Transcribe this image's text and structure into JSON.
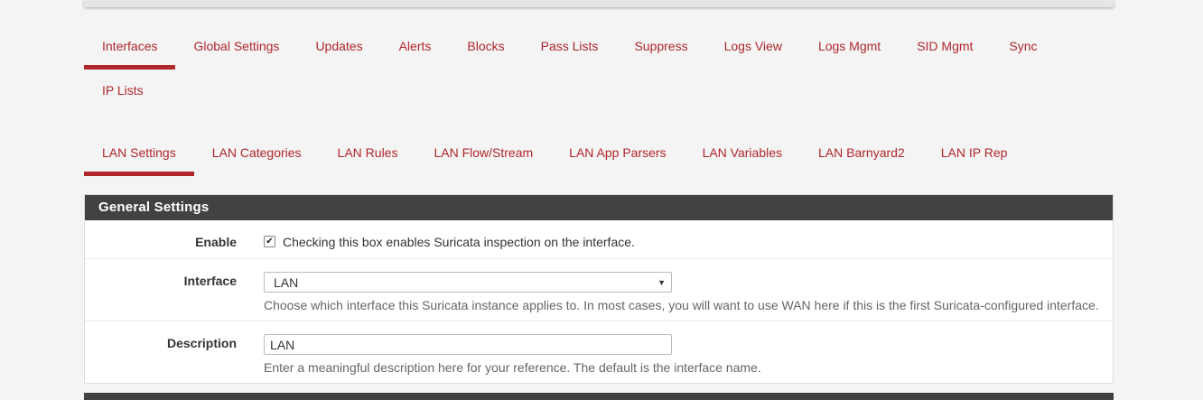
{
  "main_tabs": [
    {
      "label": "Interfaces",
      "active": true
    },
    {
      "label": "Global Settings"
    },
    {
      "label": "Updates"
    },
    {
      "label": "Alerts"
    },
    {
      "label": "Blocks"
    },
    {
      "label": "Pass Lists"
    },
    {
      "label": "Suppress"
    },
    {
      "label": "Logs View"
    },
    {
      "label": "Logs Mgmt"
    },
    {
      "label": "SID Mgmt"
    },
    {
      "label": "Sync"
    },
    {
      "label": "IP Lists"
    }
  ],
  "sub_tabs": [
    {
      "label": "LAN Settings",
      "active": true
    },
    {
      "label": "LAN Categories"
    },
    {
      "label": "LAN Rules"
    },
    {
      "label": "LAN Flow/Stream"
    },
    {
      "label": "LAN App Parsers"
    },
    {
      "label": "LAN Variables"
    },
    {
      "label": "LAN Barnyard2"
    },
    {
      "label": "LAN IP Rep"
    }
  ],
  "panel": {
    "title": "General Settings",
    "enable": {
      "label": "Enable",
      "checked": true,
      "text": "Checking this box enables Suricata inspection on the interface."
    },
    "interface": {
      "label": "Interface",
      "value": "LAN",
      "help": "Choose which interface this Suricata instance applies to. In most cases, you will want to use WAN here if this is the first Suricata-configured interface."
    },
    "description": {
      "label": "Description",
      "value": "LAN",
      "help": "Enter a meaningful description here for your reference. The default is the interface name."
    }
  },
  "colors": {
    "accent": "#b0272c",
    "panel_heading": "#424242",
    "background": "#f4f4f4"
  }
}
